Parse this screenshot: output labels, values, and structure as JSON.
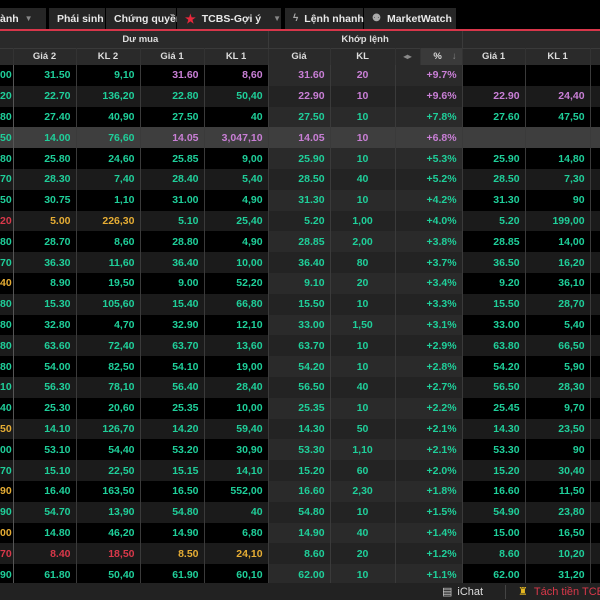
{
  "tabs": {
    "items": [
      {
        "label": "ành",
        "caret": true
      },
      {
        "label": "Phái sinh"
      },
      {
        "label": "Chứng quyền"
      },
      {
        "label": "TCBS-Gợi ý",
        "icon": "star-icon",
        "caret": true
      },
      {
        "label": "Lệnh nhanh",
        "icon": "lightning-icon"
      },
      {
        "label": "MarketWatch",
        "icon": "marketwatch-icon"
      }
    ]
  },
  "header": {
    "groups": {
      "du_mua": "Dư mua",
      "khop_lenh": "Khớp lệnh"
    },
    "columns": {
      "gia2": "Giá 2",
      "kl2": "KL 2",
      "gia1": "Giá 1",
      "kl1": "KL 1",
      "khop_gia": "Giá",
      "khop_kl": "KL",
      "arrows": "◂▸",
      "pct": "%",
      "sort": "↓",
      "ban_gia1": "Giá 1",
      "ban_kl1": "KL 1"
    }
  },
  "colors": {
    "g": "#1fcf9a",
    "p": "#c97fd6",
    "y": "#e6ad34",
    "r": "#d9384a",
    "accent": "#d8364a"
  },
  "rows": [
    {
      "v": [
        "00",
        "31.50",
        "9,10",
        "31.60",
        "8,60",
        "31.60",
        "20",
        "+9.7%",
        "",
        ""
      ],
      "c": "gggppppp  "
    },
    {
      "v": [
        "20",
        "22.70",
        "136,20",
        "22.80",
        "50,40",
        "22.90",
        "10",
        "+9.6%",
        "22.90",
        "24,40"
      ],
      "c": "gggggppppp"
    },
    {
      "v": [
        "80",
        "27.40",
        "40,90",
        "27.50",
        "40",
        "27.50",
        "10",
        "+7.8%",
        "27.60",
        "47,50"
      ],
      "c": "gggggggggg"
    },
    {
      "v": [
        "50",
        "14.00",
        "76,60",
        "14.05",
        "3,047,10",
        "14.05",
        "10",
        "+6.8%",
        "",
        ""
      ],
      "c": "gggppppp  ",
      "hl": true
    },
    {
      "v": [
        "80",
        "25.80",
        "24,60",
        "25.85",
        "9,00",
        "25.90",
        "10",
        "+5.3%",
        "25.90",
        "14,80"
      ],
      "c": "gggggggggg"
    },
    {
      "v": [
        "70",
        "28.30",
        "7,40",
        "28.40",
        "5,40",
        "28.50",
        "40",
        "+5.2%",
        "28.50",
        "7,30"
      ],
      "c": "gggggggggg"
    },
    {
      "v": [
        "50",
        "30.75",
        "1,10",
        "31.00",
        "4,90",
        "31.30",
        "10",
        "+4.2%",
        "31.30",
        "90"
      ],
      "c": "gggggggggg"
    },
    {
      "v": [
        "20",
        "5.00",
        "226,30",
        "5.10",
        "25,40",
        "5.20",
        "1,00",
        "+4.0%",
        "5.20",
        "199,00"
      ],
      "c": "ryyggggggg"
    },
    {
      "v": [
        "80",
        "28.70",
        "8,60",
        "28.80",
        "4,90",
        "28.85",
        "2,00",
        "+3.8%",
        "28.85",
        "14,00"
      ],
      "c": "gggggggggg"
    },
    {
      "v": [
        "70",
        "36.30",
        "11,60",
        "36.40",
        "10,00",
        "36.40",
        "80",
        "+3.7%",
        "36.50",
        "16,20"
      ],
      "c": "gggggggggg"
    },
    {
      "v": [
        "40",
        "8.90",
        "19,50",
        "9.00",
        "52,20",
        "9.10",
        "20",
        "+3.4%",
        "9.20",
        "36,10"
      ],
      "c": "yggggggggg"
    },
    {
      "v": [
        "80",
        "15.30",
        "105,60",
        "15.40",
        "66,80",
        "15.50",
        "10",
        "+3.3%",
        "15.50",
        "28,70"
      ],
      "c": "gggggggggg"
    },
    {
      "v": [
        "80",
        "32.80",
        "4,70",
        "32.90",
        "12,10",
        "33.00",
        "1,50",
        "+3.1%",
        "33.00",
        "5,40"
      ],
      "c": "gggggggggg"
    },
    {
      "v": [
        "80",
        "63.60",
        "72,40",
        "63.70",
        "13,60",
        "63.70",
        "10",
        "+2.9%",
        "63.80",
        "66,50"
      ],
      "c": "gggggggggg"
    },
    {
      "v": [
        "80",
        "54.00",
        "82,50",
        "54.10",
        "19,00",
        "54.20",
        "10",
        "+2.8%",
        "54.20",
        "5,90"
      ],
      "c": "gggggggggg"
    },
    {
      "v": [
        "10",
        "56.30",
        "78,10",
        "56.40",
        "28,40",
        "56.50",
        "40",
        "+2.7%",
        "56.50",
        "28,30"
      ],
      "c": "gggggggggg"
    },
    {
      "v": [
        "40",
        "25.30",
        "20,60",
        "25.35",
        "10,00",
        "25.35",
        "10",
        "+2.2%",
        "25.45",
        "9,70"
      ],
      "c": "gggggggggg"
    },
    {
      "v": [
        "50",
        "14.10",
        "126,70",
        "14.20",
        "59,40",
        "14.30",
        "50",
        "+2.1%",
        "14.30",
        "23,50"
      ],
      "c": "yggggggggg"
    },
    {
      "v": [
        "00",
        "53.10",
        "54,40",
        "53.20",
        "30,90",
        "53.30",
        "1,10",
        "+2.1%",
        "53.30",
        "90"
      ],
      "c": "gggggggggg"
    },
    {
      "v": [
        "70",
        "15.10",
        "22,50",
        "15.15",
        "14,10",
        "15.20",
        "60",
        "+2.0%",
        "15.20",
        "30,40"
      ],
      "c": "gggggggggg"
    },
    {
      "v": [
        "90",
        "16.40",
        "163,50",
        "16.50",
        "552,00",
        "16.60",
        "2,30",
        "+1.8%",
        "16.60",
        "11,50"
      ],
      "c": "yggggggggg"
    },
    {
      "v": [
        "90",
        "54.70",
        "13,90",
        "54.80",
        "40",
        "54.80",
        "10",
        "+1.5%",
        "54.90",
        "23,80"
      ],
      "c": "gggggggggg"
    },
    {
      "v": [
        "00",
        "14.80",
        "46,20",
        "14.90",
        "6,80",
        "14.90",
        "40",
        "+1.4%",
        "15.00",
        "16,50"
      ],
      "c": "yggggggggg"
    },
    {
      "v": [
        "70",
        "8.40",
        "18,50",
        "8.50",
        "24,10",
        "8.60",
        "20",
        "+1.2%",
        "8.60",
        "10,20"
      ],
      "c": "rrryyggggg"
    },
    {
      "v": [
        "90",
        "61.80",
        "50,40",
        "61.90",
        "60,10",
        "62.00",
        "10",
        "+1.1%",
        "62.00",
        "31,20"
      ],
      "c": "gggggggggg"
    }
  ],
  "bottom": {
    "ichat": "iChat",
    "promo": "Tách tiền TCB"
  }
}
